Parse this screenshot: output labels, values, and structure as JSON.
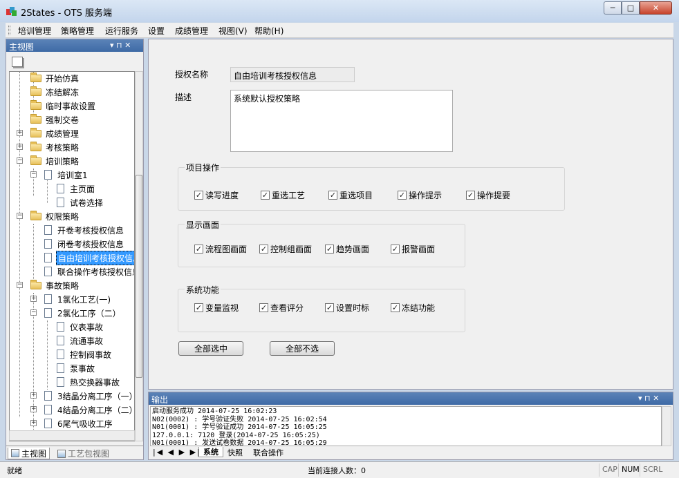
{
  "window": {
    "title": "2States - OTS 服务端",
    "min": "─",
    "max": "□",
    "close": "✕"
  },
  "menu": [
    {
      "label": "培训管理"
    },
    {
      "label": "策略管理"
    },
    {
      "label": "运行服务"
    },
    {
      "label": "设置"
    },
    {
      "label": "成绩管理"
    },
    {
      "label": "视图(V)"
    },
    {
      "label": "帮助(H)"
    }
  ],
  "left_pane": {
    "title": "主视图",
    "pin": "▾ ⊓ ✕",
    "tree": [
      {
        "label": "开始仿真",
        "type": "folder"
      },
      {
        "label": "冻结解冻",
        "type": "folder"
      },
      {
        "label": "临时事故设置",
        "type": "folder"
      },
      {
        "label": "强制交卷",
        "type": "folder"
      },
      {
        "label": "成绩管理",
        "type": "folder"
      },
      {
        "label": "考核策略",
        "type": "folder"
      },
      {
        "label": "培训策略",
        "type": "folder"
      },
      {
        "label": "培训室1",
        "type": "doc"
      },
      {
        "label": "主页面",
        "type": "doc"
      },
      {
        "label": "试卷选择",
        "type": "doc"
      },
      {
        "label": "权限策略",
        "type": "folder"
      },
      {
        "label": "开卷考核授权信息",
        "type": "doc"
      },
      {
        "label": "闭卷考核授权信息",
        "type": "doc"
      },
      {
        "label": "自由培训考核授权信息",
        "type": "doc"
      },
      {
        "label": "联合操作考核授权信息",
        "type": "doc"
      },
      {
        "label": "事故策略",
        "type": "folder"
      },
      {
        "label": "1氯化工艺(一)",
        "type": "doc"
      },
      {
        "label": "2氯化工序（二）",
        "type": "doc"
      },
      {
        "label": "仪表事故",
        "type": "doc"
      },
      {
        "label": "流通事故",
        "type": "doc"
      },
      {
        "label": "控制阀事故",
        "type": "doc"
      },
      {
        "label": "泵事故",
        "type": "doc"
      },
      {
        "label": "热交换器事故",
        "type": "doc"
      },
      {
        "label": "3结晶分离工序（一）",
        "type": "doc"
      },
      {
        "label": "4结晶分离工序（二）",
        "type": "doc"
      },
      {
        "label": "6尾气吸收工序",
        "type": "doc"
      }
    ],
    "tabs": [
      "主视图",
      "工艺包视图"
    ]
  },
  "form": {
    "name_label": "授权名称",
    "name_value": "自由培训考核授权信息",
    "desc_label": "描述",
    "desc_value": "系统默认授权策略",
    "groups": [
      {
        "title": "项目操作",
        "items": [
          "读写进度",
          "重选工艺",
          "重选项目",
          "操作提示",
          "操作提要"
        ]
      },
      {
        "title": "显示画面",
        "items": [
          "流程图画面",
          "控制组画面",
          "趋势画面",
          "报警画面"
        ]
      },
      {
        "title": "系统功能",
        "items": [
          "变量监视",
          "查看评分",
          "设置时标",
          "冻结功能"
        ]
      }
    ],
    "check_mark": "✓",
    "select_all": "全部选中",
    "select_none": "全部不选"
  },
  "output": {
    "title": "输出",
    "pin": "▾ ⊓ ✕",
    "lines": [
      "启动服务成功 2014-07-25 16:02:23",
      "N02(0002) : 学号验证失败 2014-07-25 16:02:54",
      "N01(0001) : 学号验证成功 2014-07-25 16:05:25",
      "127.0.0.1: 7120 登录(2014-07-25 16:05:25)",
      "N01(0001) : 发送试卷数据 2014-07-25 16:05:29"
    ],
    "nav": "|◀ ◀ ▶ ▶|",
    "tabs": [
      "系统",
      "快照",
      "联合操作"
    ]
  },
  "status": {
    "left": "就绪",
    "center": "当前连接人数：0",
    "keys": [
      "CAP",
      "NUM",
      "SCRL"
    ]
  }
}
